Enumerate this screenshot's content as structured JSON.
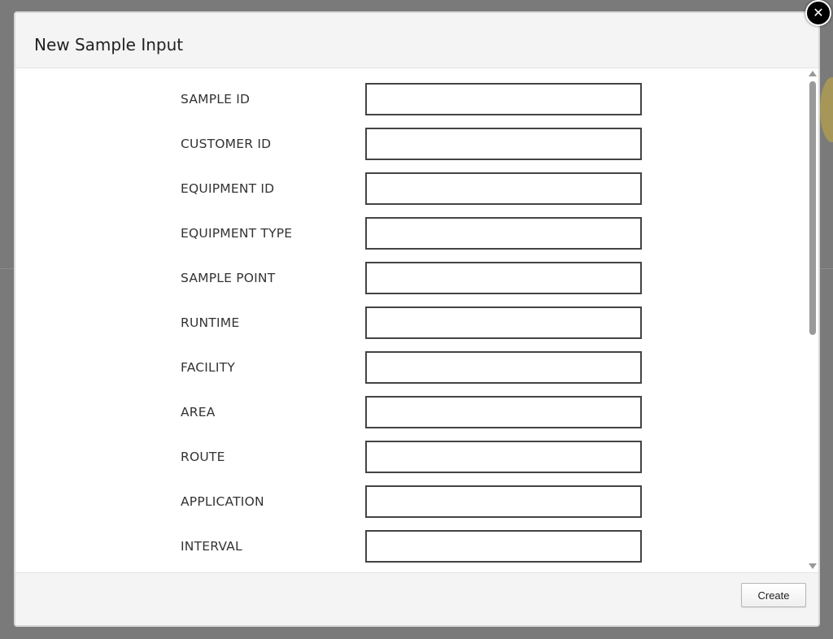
{
  "modal": {
    "title": "New Sample Input",
    "close_icon": "close-icon"
  },
  "form": {
    "fields": [
      {
        "label": "SAMPLE ID",
        "value": "",
        "placeholder": ""
      },
      {
        "label": "CUSTOMER ID",
        "value": "",
        "placeholder": ""
      },
      {
        "label": "EQUIPMENT ID",
        "value": "",
        "placeholder": ""
      },
      {
        "label": "EQUIPMENT TYPE",
        "value": "",
        "placeholder": ""
      },
      {
        "label": "SAMPLE POINT",
        "value": "",
        "placeholder": ""
      },
      {
        "label": "RUNTIME",
        "value": "",
        "placeholder": ""
      },
      {
        "label": "FACILITY",
        "value": "",
        "placeholder": ""
      },
      {
        "label": "AREA",
        "value": "",
        "placeholder": ""
      },
      {
        "label": "ROUTE",
        "value": "",
        "placeholder": ""
      },
      {
        "label": "APPLICATION",
        "value": "",
        "placeholder": ""
      },
      {
        "label": "INTERVAL",
        "value": "",
        "placeholder": ""
      }
    ]
  },
  "footer": {
    "create_label": "Create"
  },
  "colors": {
    "overlay": "#6f6f6f",
    "header_bg": "#f4f4f4",
    "input_border": "#444444",
    "scroll_thumb": "#9a9a9a"
  }
}
